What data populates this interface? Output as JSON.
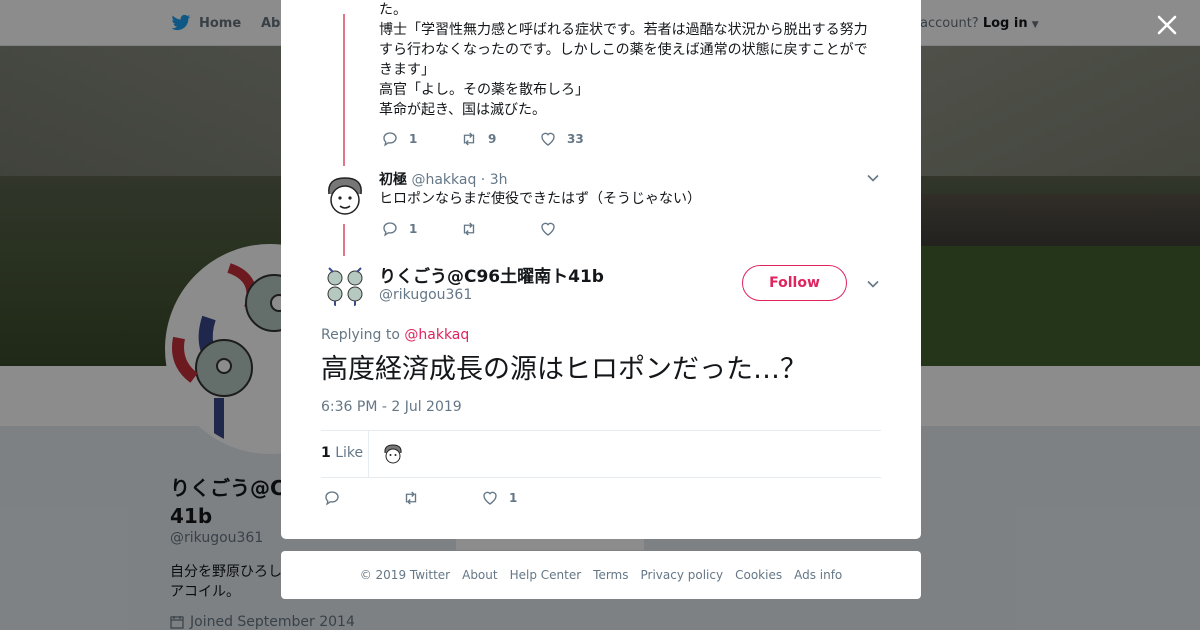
{
  "nav": {
    "home_label": "Home",
    "about_label": "Ab",
    "account_prompt": "account?",
    "login_label": "Log in"
  },
  "profile": {
    "name": "りくごう@C96土曜南ト41b",
    "name_visible": "りくごう@C",
    "name_line2": "41b",
    "handle": "@rikugou361",
    "bio_line1": "自分を野原ひろし",
    "bio_line2": "アコイル。",
    "joined": "Joined September 2014",
    "ads_info": "Ads info"
  },
  "modal": {
    "prev_tweet": {
      "lines": [
        "た。",
        "博士「学習性無力感と呼ばれる症状です。若者は過酷な状況から脱出する努力",
        "すら行わなくなったのです。しかしこの薬を使えば通常の状態に戻すことがで",
        "きます」",
        "高官「よし。その薬を散布しろ」",
        "革命が起き、国は滅びた。"
      ],
      "replies": "1",
      "retweets": "9",
      "likes": "33"
    },
    "reply": {
      "name": "初極",
      "handle": "@hakkaq",
      "time": "· 3h",
      "text": "ヒロポンならまだ使役できたはず（そうじゃない）",
      "replies": "1"
    },
    "main_tweet": {
      "name": "りくごう@C96土曜南ト41b",
      "handle": "@rikugou361",
      "follow_label": "Follow",
      "replying_prefix": "Replying to",
      "replying_to": "@hakkaq",
      "text": "高度経済成長の源はヒロポンだった…？",
      "timestamp": "6:36 PM - 2 Jul 2019",
      "like_count": "1",
      "like_label": "Like",
      "action_likes": "1"
    }
  },
  "footer": {
    "links": [
      "© 2019 Twitter",
      "About",
      "Help Center",
      "Terms",
      "Privacy policy",
      "Cookies",
      "Ads info"
    ]
  },
  "colors": {
    "accent": "#e0245e",
    "thread_line": "#e1768a",
    "twitter_blue": "#1da1f2"
  }
}
